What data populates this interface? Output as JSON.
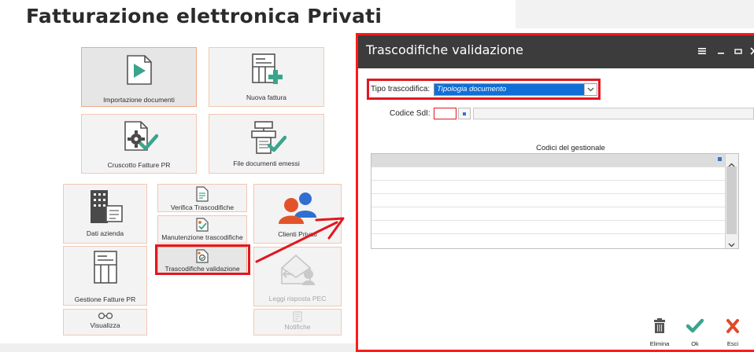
{
  "page": {
    "title": "Fatturazione elettronica Privati"
  },
  "tiles": {
    "import": "Importazione documenti",
    "new_invoice": "Nuova fattura",
    "dashboard": "Cruscotto Fatture PR",
    "issued_files": "File documenti emessi",
    "company": "Dati azienda",
    "verify": "Verifica Trascodifiche",
    "clients": "Clienti Privati",
    "maintenance": "Manutenzione trascodifiche",
    "validation": "Trascodifiche validazione",
    "manage": "Gestione Fatture PR",
    "pec": "Leggi risposta PEC",
    "view": "Visualizza",
    "notifications": "Notifiche"
  },
  "dialog": {
    "title": "Trascodifiche validazione",
    "type_label": "Tipo trascodifica:",
    "type_value": "Tipologia documento",
    "sdi_label": "Codice SdI:",
    "sdi_value": "",
    "sdi_description": "",
    "grid_title": "Codici del gestionale",
    "grid_rows": [
      "",
      "",
      "",
      "",
      "",
      "",
      ""
    ],
    "buttons": {
      "delete": "Elimina",
      "ok": "Ok",
      "exit": "Esci"
    }
  },
  "colors": {
    "highlight": "#e1171f",
    "accent": "#0f6fd6",
    "titlebar": "#3c3c3c",
    "tile_border": "#f4c7b3",
    "teal": "#3aa58c"
  }
}
